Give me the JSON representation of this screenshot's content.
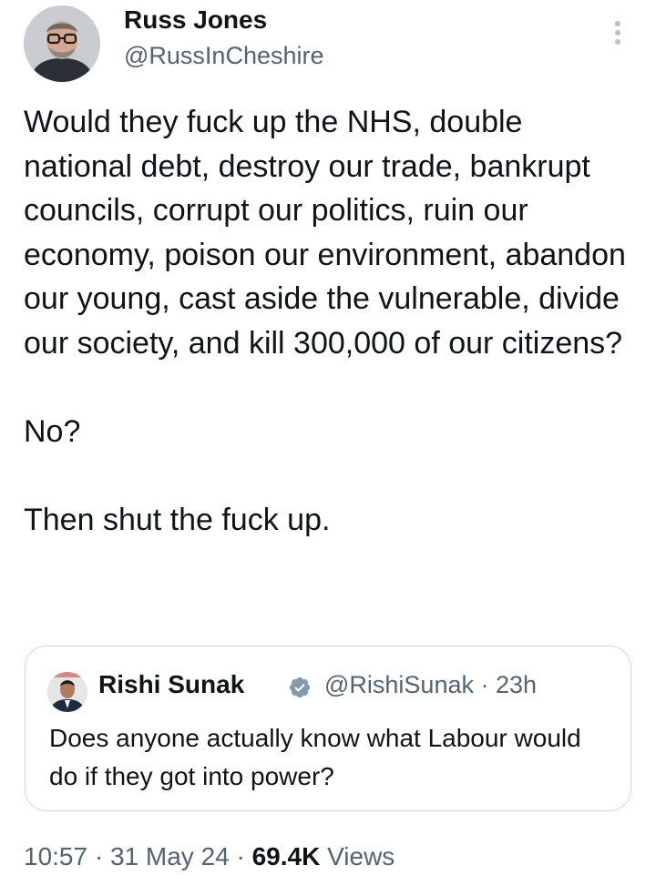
{
  "author": {
    "display_name": "Russ Jones",
    "handle": "@RussInCheshire"
  },
  "tweet": {
    "paragraphs": [
      "Would they fuck up the NHS, double national debt, destroy our trade, bankrupt councils, corrupt our politics, ruin our economy, poison our environment, abandon our young, cast aside the vulnerable, divide our society, and kill 300,000 of our citizens?",
      "No?",
      "Then shut the fuck up."
    ]
  },
  "quoted_tweet": {
    "display_name": "Rishi Sunak",
    "handle_time": "@RishiSunak · 23h",
    "text": "Does anyone actually know what Labour would do if they got into power?"
  },
  "meta": {
    "time": "10:57",
    "date": "31 May 24",
    "separator": "·",
    "views_count": "69.4K",
    "views_label": "Views"
  },
  "colors": {
    "text_primary": "#0f1419",
    "text_secondary": "#536471",
    "border": "#cfd9de",
    "verified_badge": "#829aab"
  },
  "icons": {
    "more": "more-vertical-icon",
    "verified": "verified-badge-icon"
  }
}
